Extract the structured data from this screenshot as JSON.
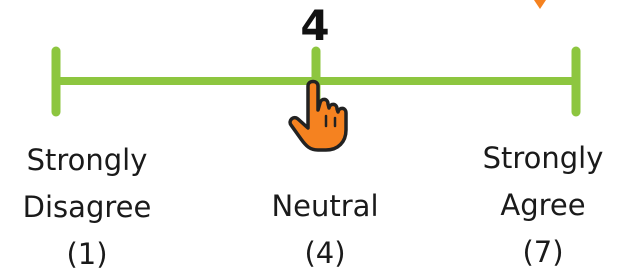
{
  "scale": {
    "current_value": "4",
    "accent_color": "#8dc63f",
    "cursor_color": "#f58220",
    "min_label_line1": "Strongly",
    "min_label_line2": "Disagree",
    "min_value_label": "(1)",
    "mid_label": "Neutral",
    "mid_value_label": "(4)",
    "max_label_line1": "Strongly",
    "max_label_line2": "Agree",
    "max_value_label": "(7)"
  },
  "icons": {
    "cursor": "hand-pointer-icon",
    "corner": "arrow-down-icon"
  }
}
